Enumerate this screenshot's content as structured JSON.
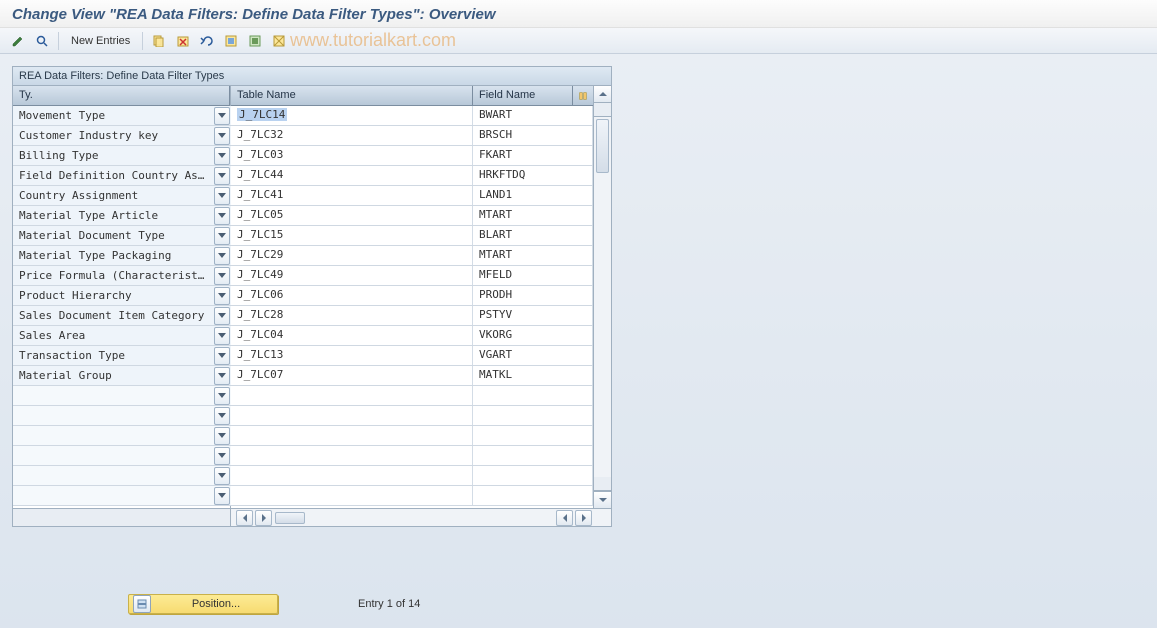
{
  "title": "Change View \"REA Data Filters: Define Data Filter Types\": Overview",
  "watermark": "www.tutorialkart.com",
  "toolbar": {
    "new_entries_label": "New Entries"
  },
  "card_title": "REA Data Filters: Define Data Filter Types",
  "columns": {
    "type": "Ty.",
    "table": "Table Name",
    "field": "Field Name"
  },
  "selected_row": 0,
  "rows": [
    {
      "type": "Movement Type",
      "table": "J_7LC14",
      "field": "BWART"
    },
    {
      "type": "Customer Industry key",
      "table": "J_7LC32",
      "field": "BRSCH"
    },
    {
      "type": "Billing Type",
      "table": "J_7LC03",
      "field": "FKART"
    },
    {
      "type": "Field Definition Country As…",
      "table": "J_7LC44",
      "field": "HRKFTDQ"
    },
    {
      "type": "Country Assignment",
      "table": "J_7LC41",
      "field": "LAND1"
    },
    {
      "type": "Material Type Article",
      "table": "J_7LC05",
      "field": "MTART"
    },
    {
      "type": "Material Document Type",
      "table": "J_7LC15",
      "field": "BLART"
    },
    {
      "type": "Material Type Packaging",
      "table": "J_7LC29",
      "field": "MTART"
    },
    {
      "type": "Price Formula (Characterist…",
      "table": "J_7LC49",
      "field": "MFELD"
    },
    {
      "type": "Product Hierarchy",
      "table": "J_7LC06",
      "field": "PRODH"
    },
    {
      "type": "Sales Document Item Category",
      "table": "J_7LC28",
      "field": "PSTYV"
    },
    {
      "type": "Sales Area",
      "table": "J_7LC04",
      "field": "VKORG"
    },
    {
      "type": "Transaction Type",
      "table": "J_7LC13",
      "field": "VGART"
    },
    {
      "type": "Material Group",
      "table": "J_7LC07",
      "field": "MATKL"
    }
  ],
  "empty_rows": 6,
  "bottom": {
    "position_label": "Position...",
    "entry_text": "Entry 1 of 14"
  },
  "colors": {
    "header_bg": "#b8c8d8",
    "row_odd": "#eef4fa",
    "accent_yellow": "#fceb94",
    "watermark": "#e8b478",
    "title": "#3b5a80"
  }
}
